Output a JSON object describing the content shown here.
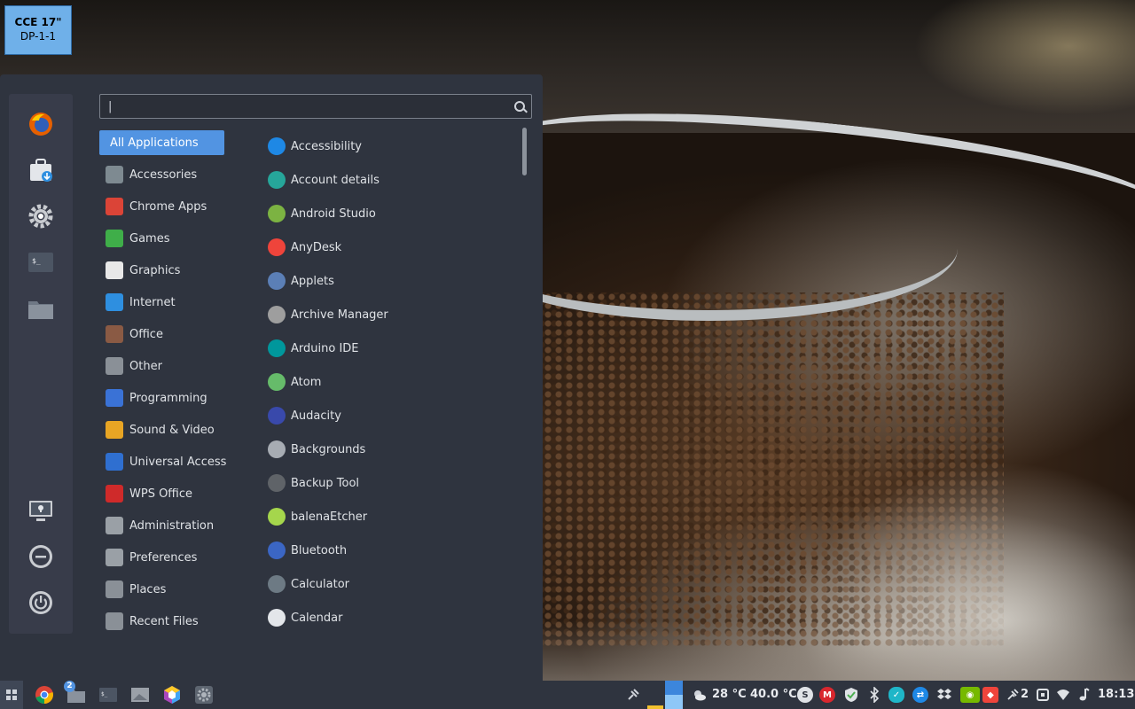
{
  "display_label": {
    "line1": "CCE 17\"",
    "line2": "DP-1-1"
  },
  "search": {
    "value": "",
    "placeholder": ""
  },
  "favorites": [
    {
      "icon": "firefox-icon"
    },
    {
      "icon": "software-store-icon"
    },
    {
      "icon": "settings-icon"
    },
    {
      "icon": "terminal-icon"
    },
    {
      "icon": "folder-icon"
    }
  ],
  "session_buttons": [
    {
      "icon": "lock-screen-icon"
    },
    {
      "icon": "logout-icon"
    },
    {
      "icon": "power-icon"
    }
  ],
  "categories": [
    {
      "label": "All Applications",
      "selected": true
    },
    {
      "label": "Accessories",
      "color": "#7e8a91"
    },
    {
      "label": "Chrome Apps",
      "color": "#db4437"
    },
    {
      "label": "Games",
      "color": "#3fae49"
    },
    {
      "label": "Graphics",
      "color": "#e8e8e8"
    },
    {
      "label": "Internet",
      "color": "#2e8fe0"
    },
    {
      "label": "Office",
      "color": "#8a5a44"
    },
    {
      "label": "Other",
      "color": "#8a9097"
    },
    {
      "label": "Programming",
      "color": "#3a72d6"
    },
    {
      "label": "Sound & Video",
      "color": "#e8a524"
    },
    {
      "label": "Universal Access",
      "color": "#2f6fd0"
    },
    {
      "label": "WPS Office",
      "color": "#cf2a2a"
    },
    {
      "label": "Administration",
      "color": "#9aa0a6"
    },
    {
      "label": "Preferences",
      "color": "#9aa0a6"
    },
    {
      "label": "Places",
      "color": "#8a9097"
    },
    {
      "label": "Recent Files",
      "color": "#8a9097"
    }
  ],
  "applications": [
    {
      "label": "Accessibility",
      "color": "#1e88e5"
    },
    {
      "label": "Account details",
      "color": "#26a69a"
    },
    {
      "label": "Android Studio",
      "color": "#7cb342"
    },
    {
      "label": "AnyDesk",
      "color": "#ef443b"
    },
    {
      "label": "Applets",
      "color": "#5b7fb6"
    },
    {
      "label": "Archive Manager",
      "color": "#9e9e9e"
    },
    {
      "label": "Arduino IDE",
      "color": "#00979c"
    },
    {
      "label": "Atom",
      "color": "#66bb6a"
    },
    {
      "label": "Audacity",
      "color": "#3949ab"
    },
    {
      "label": "Backgrounds",
      "color": "#a7acb3"
    },
    {
      "label": "Backup Tool",
      "color": "#5f6368"
    },
    {
      "label": "balenaEtcher",
      "color": "#a5d64c"
    },
    {
      "label": "Bluetooth",
      "color": "#3b66c4"
    },
    {
      "label": "Calculator",
      "color": "#6d7a84"
    },
    {
      "label": "Calendar",
      "color": "#e3e6ea"
    }
  ],
  "taskbar": {
    "workspace_badge": "2",
    "weather": "28 °C",
    "cpu_temp": "40.0 °C",
    "notif_count": "2",
    "clock": "18:13"
  }
}
